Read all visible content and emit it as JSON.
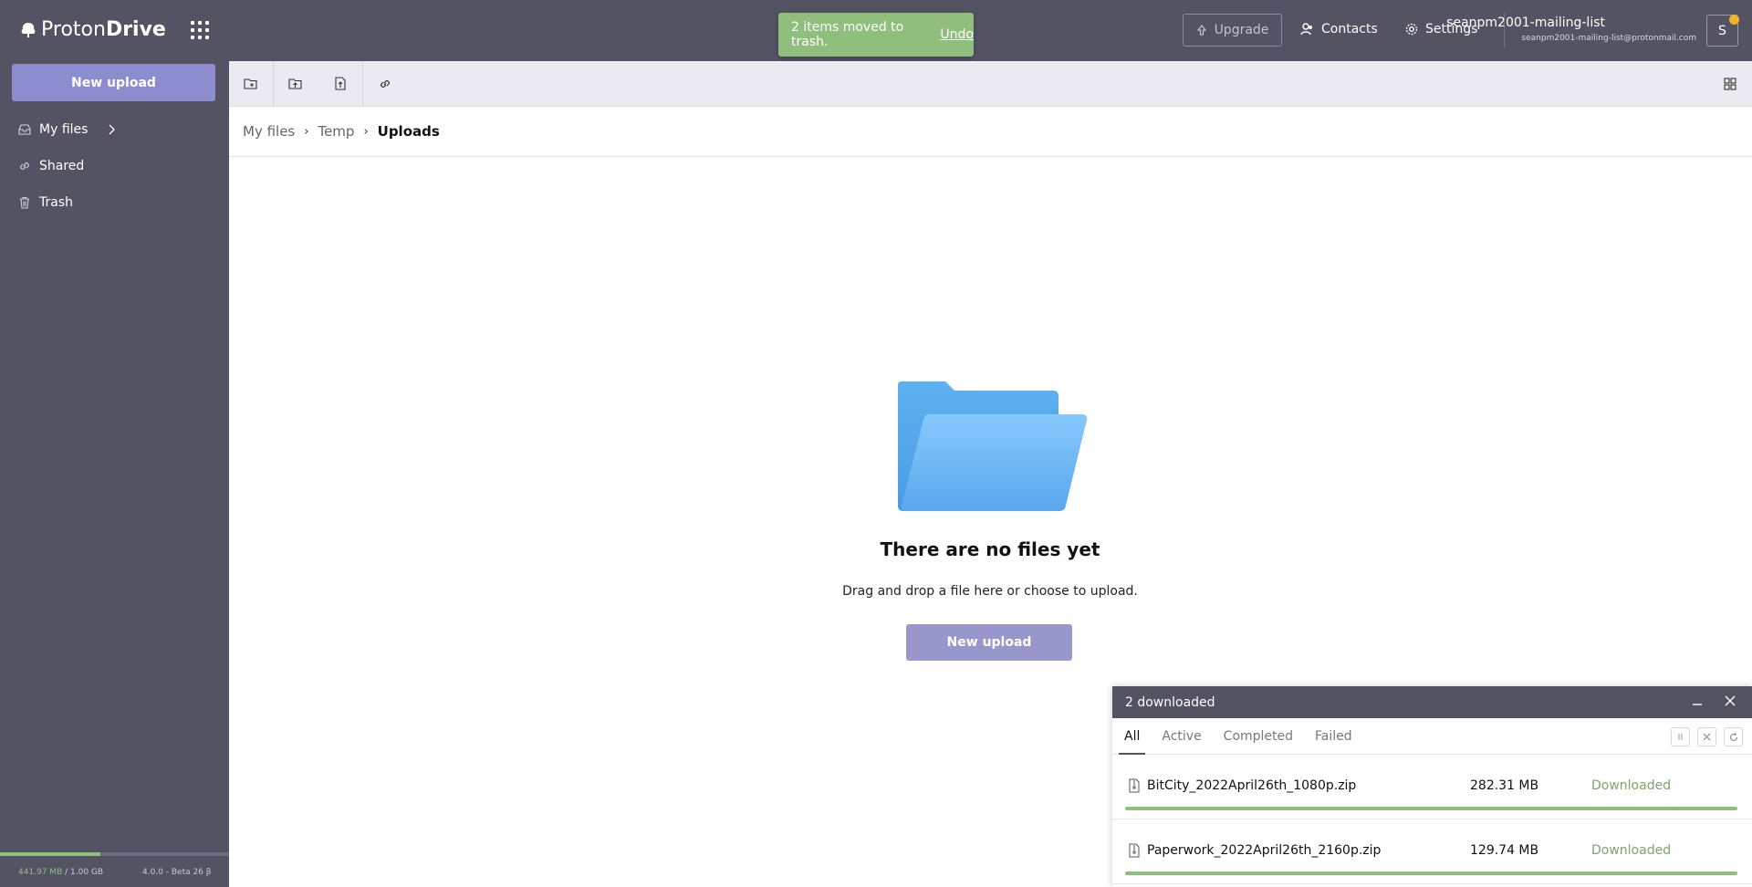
{
  "app": {
    "name_light": "Proton",
    "name_bold": "Drive"
  },
  "toast": {
    "message": "2 items moved to trash.",
    "undo_label": "Undo"
  },
  "header": {
    "upgrade_label": "Upgrade",
    "contacts_label": "Contacts",
    "settings_label": "Settings",
    "user_name": "seanpm2001-mailing-list",
    "user_email": "seanpm2001-mailing-list@protonmail.com",
    "avatar_initial": "S"
  },
  "sidebar": {
    "new_upload_label": "New upload",
    "items": [
      {
        "label": "My files",
        "icon": "inbox-icon"
      },
      {
        "label": "Shared",
        "icon": "link-icon"
      },
      {
        "label": "Trash",
        "icon": "trash-icon"
      }
    ],
    "storage_used": "441.97 MB",
    "storage_total": " / 1.00 GB",
    "storage_fraction": 0.44,
    "version": "4.0.0 - Beta 26 β"
  },
  "breadcrumb": {
    "items": [
      "My files",
      "Temp",
      "Uploads"
    ]
  },
  "empty_state": {
    "title": "There are no files yet",
    "subtitle": "Drag and drop a file here or choose to upload.",
    "button_label": "New upload"
  },
  "transfers": {
    "title": "2 downloaded",
    "tabs": [
      "All",
      "Active",
      "Completed",
      "Failed"
    ],
    "active_tab": "All",
    "rows": [
      {
        "name": "BitCity_2022April26th_1080p.zip",
        "size": "282.31 MB",
        "status": "Downloaded",
        "progress": 1.0
      },
      {
        "name": "Paperwork_2022April26th_2160p.zip",
        "size": "129.74 MB",
        "status": "Downloaded",
        "progress": 1.0
      }
    ]
  },
  "colors": {
    "header_bg": "#535364",
    "accent": "#8c8cce",
    "success": "#8fbe7d",
    "toast_bg": "#8fbe7d"
  }
}
